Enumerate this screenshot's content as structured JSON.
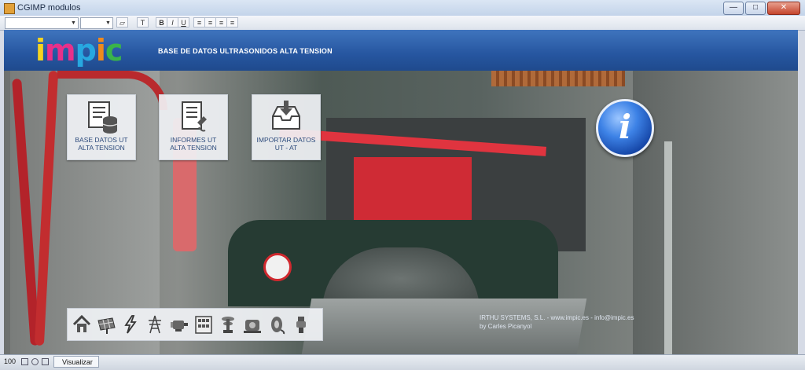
{
  "window": {
    "title": "CGIMP modulos"
  },
  "window_controls": {
    "minimize": "—",
    "maximize": "□",
    "close": "✕"
  },
  "toolbar": {
    "font_combo": "",
    "size_combo": "",
    "buttons": [
      "T",
      "B",
      "I",
      "U"
    ]
  },
  "header": {
    "logo_letters": [
      "i",
      "m",
      "p",
      "i",
      "c"
    ],
    "logo_colors": [
      "#f5d420",
      "#e8308a",
      "#27a8e0",
      "#f08a1c",
      "#3ab44a"
    ],
    "title": "BASE DE DATOS ULTRASONIDOS ALTA TENSION"
  },
  "menu": [
    {
      "line1": "BASE DATOS UT",
      "line2": "ALTA TENSION",
      "icon": "database-document-icon"
    },
    {
      "line1": "INFORMES UT",
      "line2": "ALTA TENSION",
      "icon": "report-document-icon"
    },
    {
      "line1": "IMPORTAR DATOS",
      "line2": "UT - AT",
      "icon": "import-tray-icon"
    }
  ],
  "info": {
    "glyph": "i"
  },
  "strip_icons": [
    "home-icon",
    "solar-panel-icon",
    "lightning-icon",
    "power-tower-icon",
    "motor-icon",
    "switchgear-cabinet-icon",
    "insulator-icon",
    "generator-icon",
    "cable-reel-icon",
    "bushing-icon"
  ],
  "credits": {
    "line1": "IRTHU SYSTEMS, S.L.  -  www.impic.es  -  info@impic.es",
    "line2": "by  Carles Picanyol"
  },
  "statusbar": {
    "zoom": "100",
    "tab": "Visualizar"
  },
  "colors": {
    "header_blue": "#2656a0",
    "tile_text": "#2d4b7c",
    "info_blue": "#1647a8"
  }
}
